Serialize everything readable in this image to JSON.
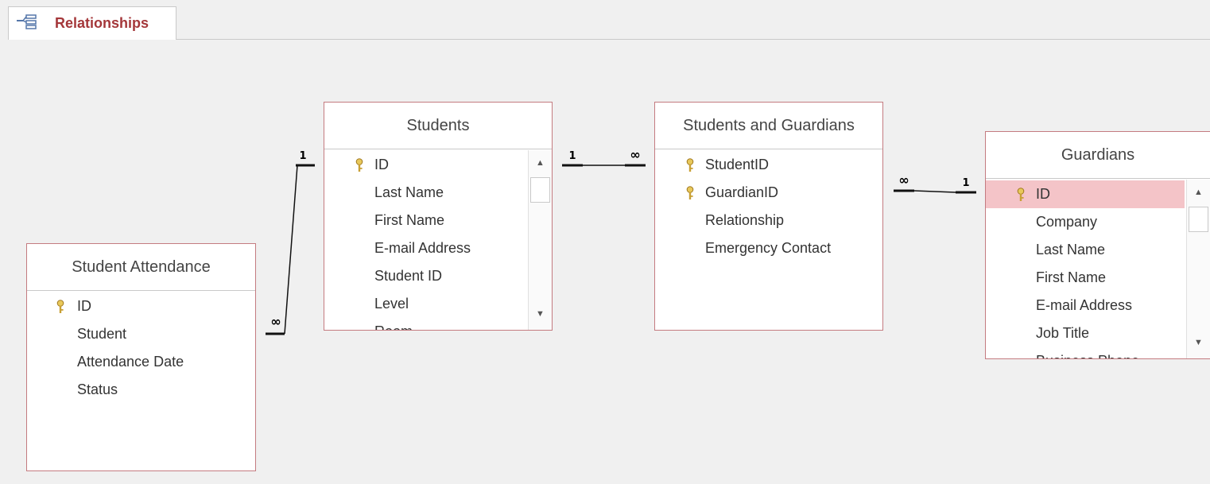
{
  "tab": {
    "title": "Relationships",
    "icon": "relationships-icon"
  },
  "tables": {
    "student_attendance": {
      "title": "Student Attendance",
      "fields": [
        "ID",
        "Student",
        "Attendance Date",
        "Status"
      ]
    },
    "students": {
      "title": "Students",
      "fields": [
        "ID",
        "Last Name",
        "First Name",
        "E-mail Address",
        "Student ID",
        "Level",
        "Room"
      ]
    },
    "students_guardians": {
      "title": "Students and Guardians",
      "fields": [
        "StudentID",
        "GuardianID",
        "Relationship",
        "Emergency Contact"
      ]
    },
    "guardians": {
      "title": "Guardians",
      "fields": [
        "ID",
        "Company",
        "Last Name",
        "First Name",
        "E-mail Address",
        "Job Title",
        "Business Phone"
      ]
    }
  },
  "relationships": [
    {
      "from": "Student Attendance",
      "to": "Students",
      "one_label": "1",
      "many_label": "∞"
    },
    {
      "from": "Students",
      "to": "Students and Guardians",
      "one_label": "1",
      "many_label": "∞"
    },
    {
      "from": "Students and Guardians",
      "to": "Guardians",
      "one_label": "1",
      "many_label": "∞"
    }
  ],
  "colors": {
    "tab_text": "#a4373a",
    "table_border": "#c47b80",
    "selected_row": "#f4c4c8",
    "key_icon": "#c8a035"
  }
}
